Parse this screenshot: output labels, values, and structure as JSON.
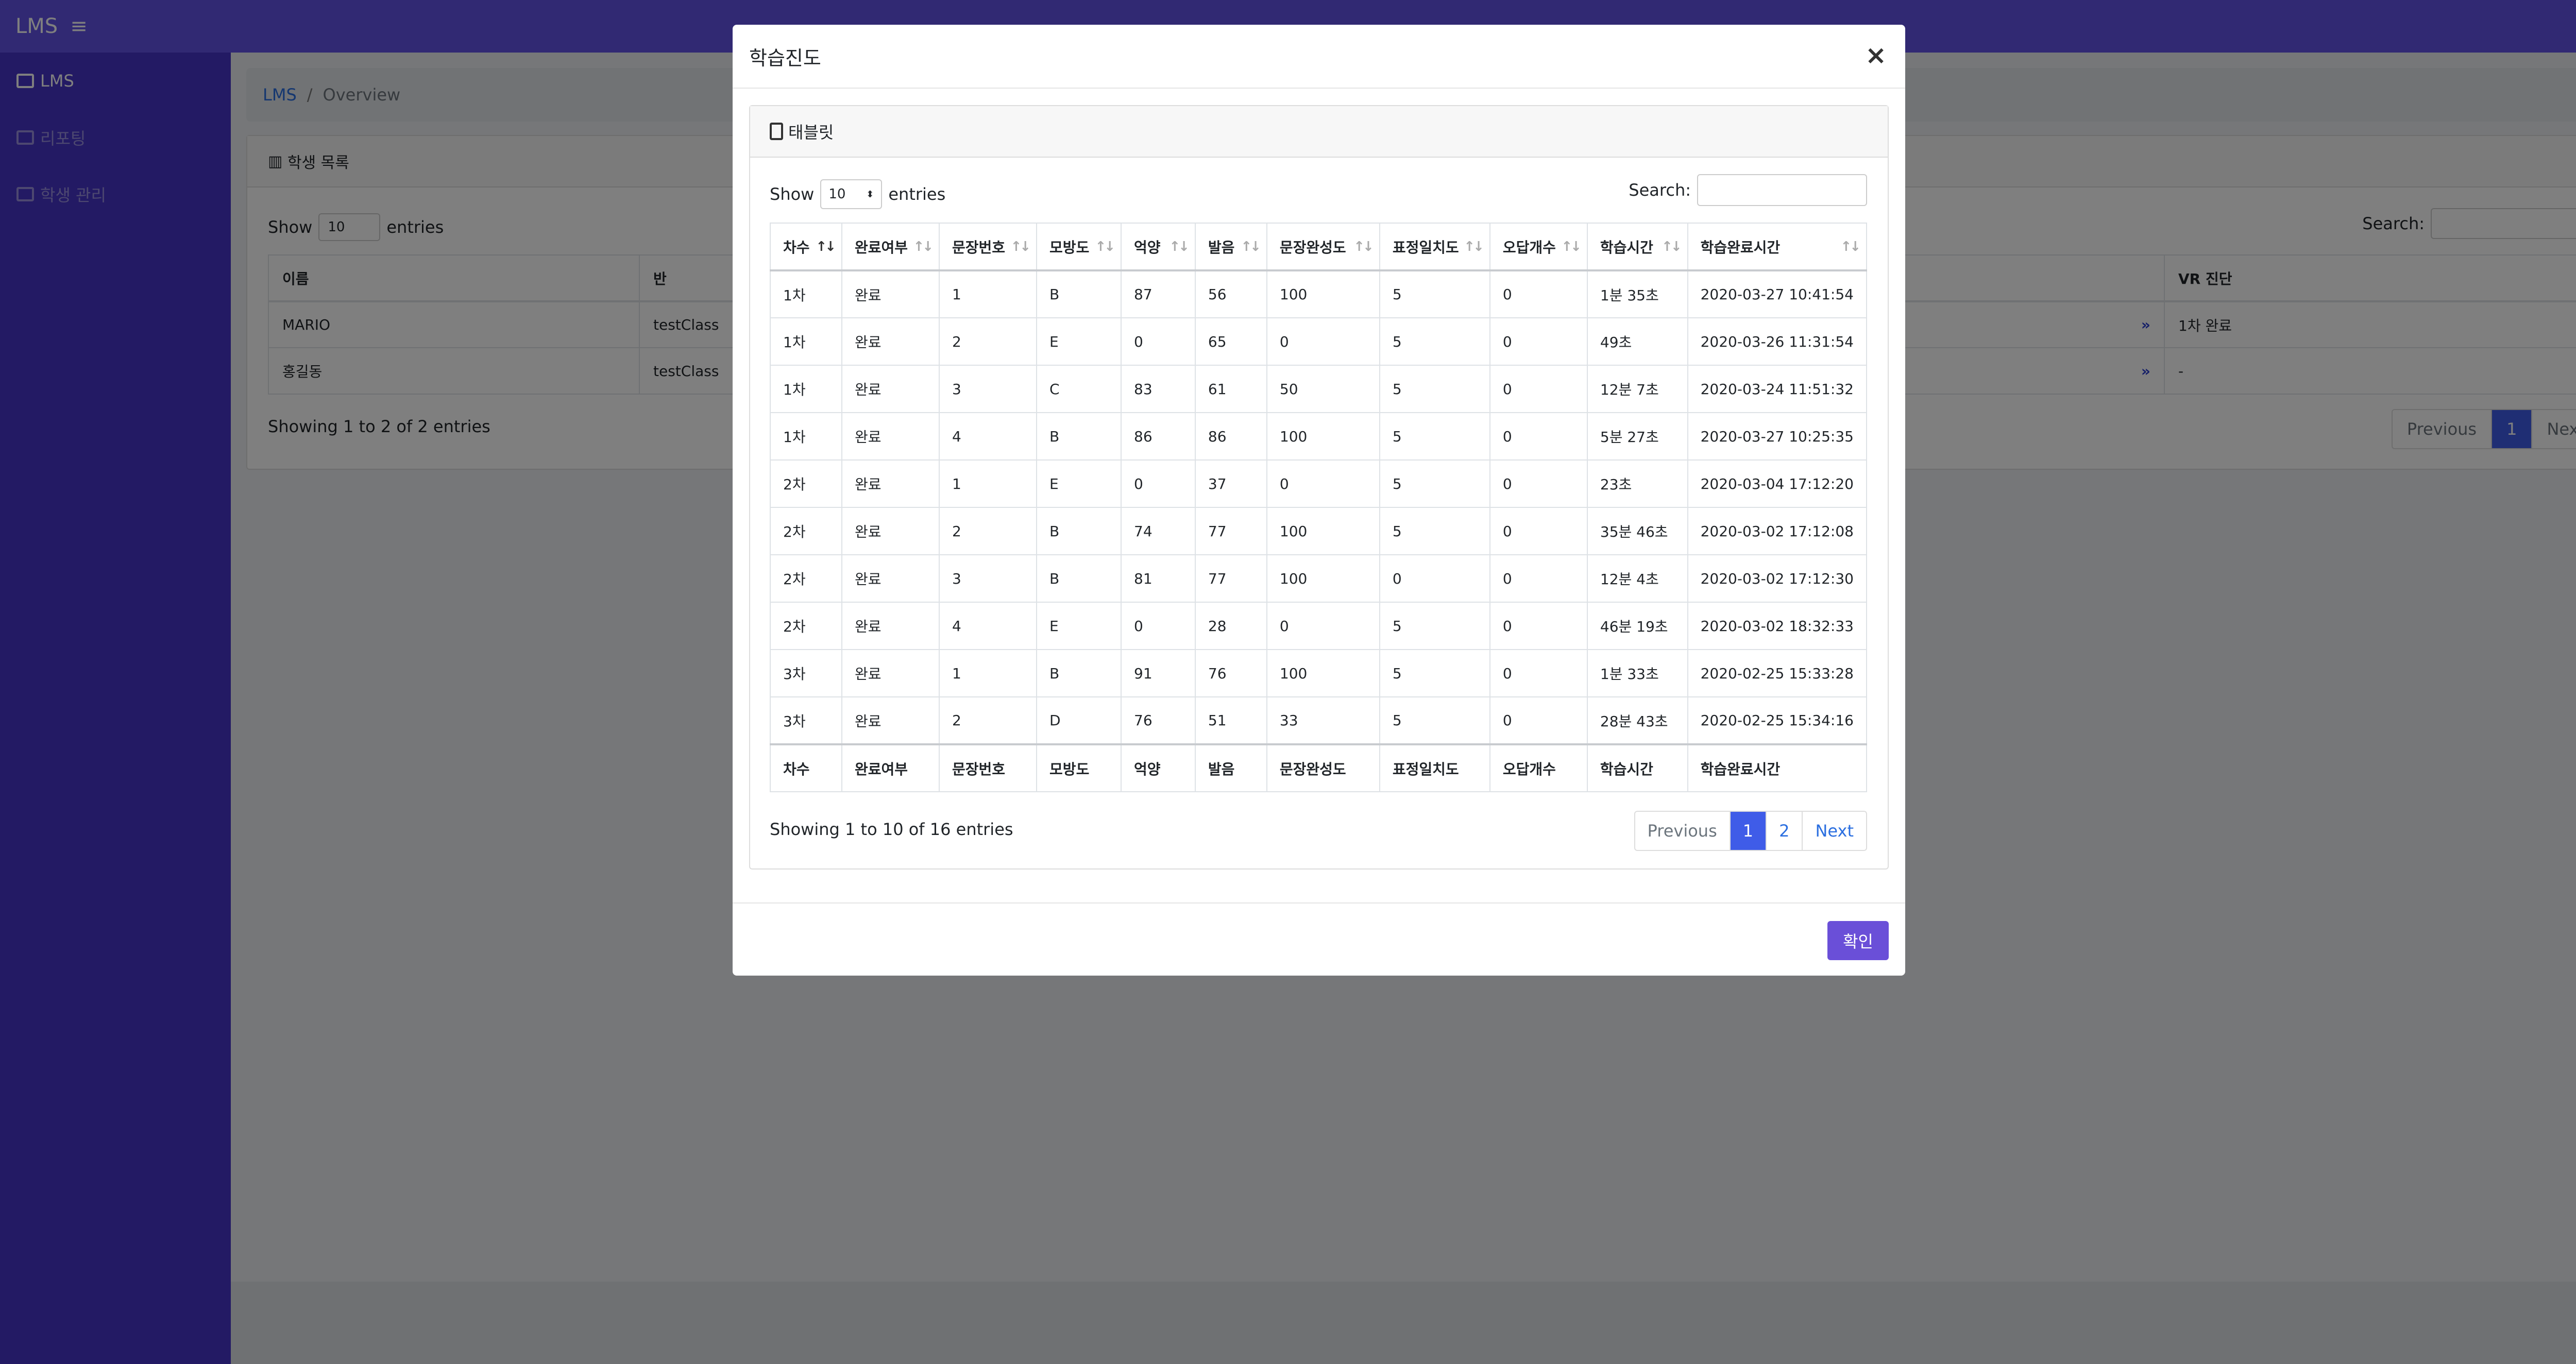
{
  "app": {
    "brand": "LMS",
    "menu_icon": "≡"
  },
  "sidebar": {
    "items": [
      {
        "label": "LMS",
        "icon": "users-icon"
      },
      {
        "label": "리포팅",
        "icon": "file-icon"
      },
      {
        "label": "학생 관리",
        "icon": "edit-icon"
      }
    ]
  },
  "breadcrumb": {
    "root": "LMS",
    "separator": "/",
    "current": "Overview"
  },
  "student_list": {
    "title": "학생 목록",
    "show_label": "Show",
    "entries_label": "entries",
    "page_size": "10",
    "search_label": "Search:",
    "columns": [
      "이름",
      "반",
      "VR 진단"
    ],
    "rows": [
      {
        "name": "MARIO",
        "class": "testClass",
        "vr": "1차 완료"
      },
      {
        "name": "홍길동",
        "class": "testClass",
        "vr": "-"
      }
    ],
    "info": "Showing 1 to 2 of 2 entries",
    "pagination": {
      "prev": "Previous",
      "page": "1",
      "next": "Next"
    }
  },
  "modal": {
    "title": "학습진도",
    "close": "×",
    "card_title": "태블릿",
    "show_label": "Show",
    "entries_label": "entries",
    "page_size": "10",
    "search_label": "Search:",
    "columns": [
      "차수",
      "완료여부",
      "문장번호",
      "모방도",
      "억양",
      "발음",
      "문장완성도",
      "표정일치도",
      "오답개수",
      "학습시간",
      "학습완료시간"
    ],
    "rows": [
      [
        "1차",
        "완료",
        "1",
        "B",
        "87",
        "56",
        "100",
        "5",
        "0",
        "1분 35초",
        "2020-03-27 10:41:54"
      ],
      [
        "1차",
        "완료",
        "2",
        "E",
        "0",
        "65",
        "0",
        "5",
        "0",
        "49초",
        "2020-03-26 11:31:54"
      ],
      [
        "1차",
        "완료",
        "3",
        "C",
        "83",
        "61",
        "50",
        "5",
        "0",
        "12분 7초",
        "2020-03-24 11:51:32"
      ],
      [
        "1차",
        "완료",
        "4",
        "B",
        "86",
        "86",
        "100",
        "5",
        "0",
        "5분 27초",
        "2020-03-27 10:25:35"
      ],
      [
        "2차",
        "완료",
        "1",
        "E",
        "0",
        "37",
        "0",
        "5",
        "0",
        "23초",
        "2020-03-04 17:12:20"
      ],
      [
        "2차",
        "완료",
        "2",
        "B",
        "74",
        "77",
        "100",
        "5",
        "0",
        "35분 46초",
        "2020-03-02 17:12:08"
      ],
      [
        "2차",
        "완료",
        "3",
        "B",
        "81",
        "77",
        "100",
        "0",
        "0",
        "12분 4초",
        "2020-03-02 17:12:30"
      ],
      [
        "2차",
        "완료",
        "4",
        "E",
        "0",
        "28",
        "0",
        "5",
        "0",
        "46분 19초",
        "2020-03-02 18:32:33"
      ],
      [
        "3차",
        "완료",
        "1",
        "B",
        "91",
        "76",
        "100",
        "5",
        "0",
        "1분 33초",
        "2020-02-25 15:33:28"
      ],
      [
        "3차",
        "완료",
        "2",
        "D",
        "76",
        "51",
        "33",
        "5",
        "0",
        "28분 43초",
        "2020-02-25 15:34:16"
      ]
    ],
    "info": "Showing 1 to 10 of 16 entries",
    "pagination": {
      "prev": "Previous",
      "pages": [
        "1",
        "2"
      ],
      "next": "Next"
    },
    "ok_label": "확인"
  },
  "colors": {
    "topbar": "#6253e6",
    "sidebar": "#4735c9",
    "primary": "#3f5ce8",
    "ok_button": "#6a4fd8"
  }
}
